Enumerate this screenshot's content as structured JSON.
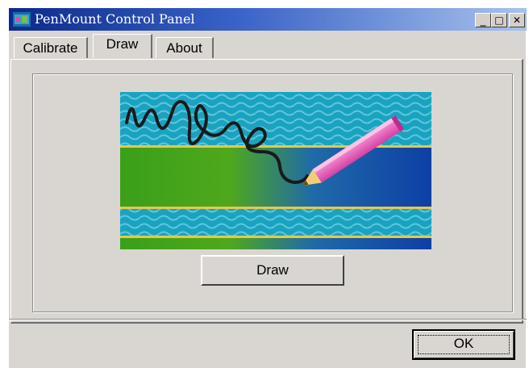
{
  "window": {
    "title": "PenMount Control Panel"
  },
  "caption_buttons": {
    "minimize": "_",
    "maximize": "□",
    "close": "✕"
  },
  "tabs": [
    {
      "label": "Calibrate",
      "active": false
    },
    {
      "label": "Draw",
      "active": true
    },
    {
      "label": "About",
      "active": false
    }
  ],
  "draw_panel": {
    "draw_button": "Draw",
    "banner_icon": "handwriting-pencil-illustration"
  },
  "footer": {
    "ok_button": "OK"
  },
  "colors": {
    "titlebar_dark": "#0a2a8c",
    "titlebar_light": "#a9c2ec",
    "dialog_bg": "#d9d6d1"
  }
}
